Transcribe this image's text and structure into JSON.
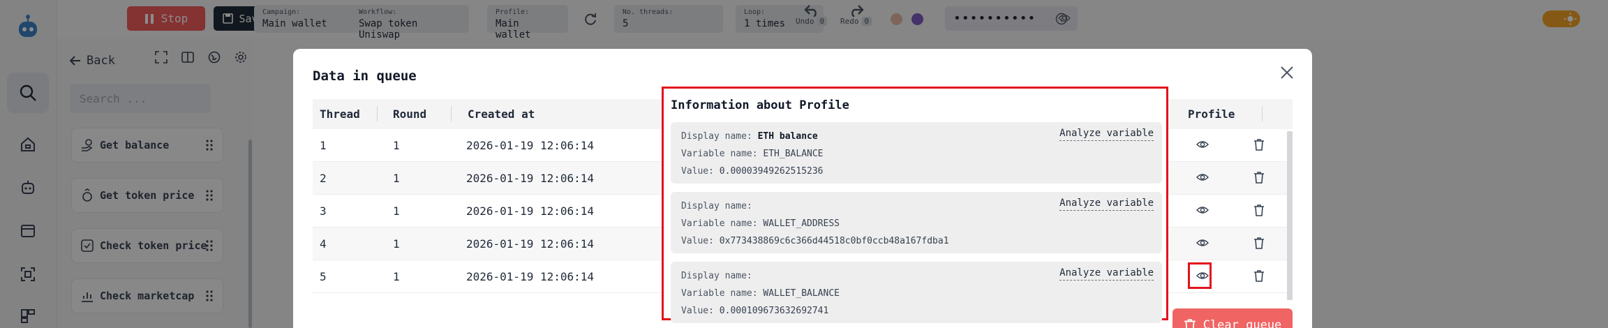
{
  "topbar": {
    "stop_label": "Stop",
    "save_label": "Save",
    "chips": [
      {
        "key": "Campaign:",
        "value": "Main wallet"
      },
      {
        "key": "Workflow:",
        "value": "Swap token Uniswap"
      },
      {
        "key": "Profile:",
        "value": "Main wallet"
      },
      {
        "key": "No. threads:",
        "value": "5"
      },
      {
        "key": "Loop:",
        "value": "1 times"
      }
    ],
    "undo_label": "Undo",
    "undo_count": "0",
    "redo_label": "Redo",
    "redo_count": "0",
    "password_mask": "••••••••••",
    "colors": {
      "dot1": "#e8b9a3",
      "dot2": "#7c5cc4",
      "accent": "#f2a227"
    }
  },
  "panel": {
    "back_label": "Back",
    "search_placeholder": "Search ...",
    "nodes": [
      {
        "label": "Get balance"
      },
      {
        "label": "Get token price"
      },
      {
        "label": "Check token price"
      },
      {
        "label": "Check marketcap"
      }
    ]
  },
  "modal": {
    "title": "Data in queue",
    "columns": {
      "thread": "Thread",
      "round": "Round",
      "created": "Created at",
      "profile": "Profile"
    },
    "rows": [
      {
        "thread": "1",
        "round": "1",
        "created": "2026-01-19 12:06:14"
      },
      {
        "thread": "2",
        "round": "1",
        "created": "2026-01-19 12:06:14"
      },
      {
        "thread": "3",
        "round": "1",
        "created": "2026-01-19 12:06:14"
      },
      {
        "thread": "4",
        "round": "1",
        "created": "2026-01-19 12:06:14"
      },
      {
        "thread": "5",
        "round": "1",
        "created": "2026-01-19 12:06:14"
      }
    ],
    "clear_label": "Clear queue"
  },
  "popover": {
    "title": "Information about Profile",
    "display_label": "Display name:",
    "variable_label": "Variable name:",
    "value_label": "Value:",
    "analyze_label": "Analyze variable",
    "cards": [
      {
        "display": "ETH balance",
        "variable": "ETH_BALANCE",
        "value": "0.00003949262515236"
      },
      {
        "display": "",
        "variable": "WALLET_ADDRESS",
        "value": "0x773438869c6c366d44518c0bf0ccb48a167fdba1"
      },
      {
        "display": "",
        "variable": "WALLET_BALANCE",
        "value": "0.000109673632692741"
      }
    ]
  }
}
